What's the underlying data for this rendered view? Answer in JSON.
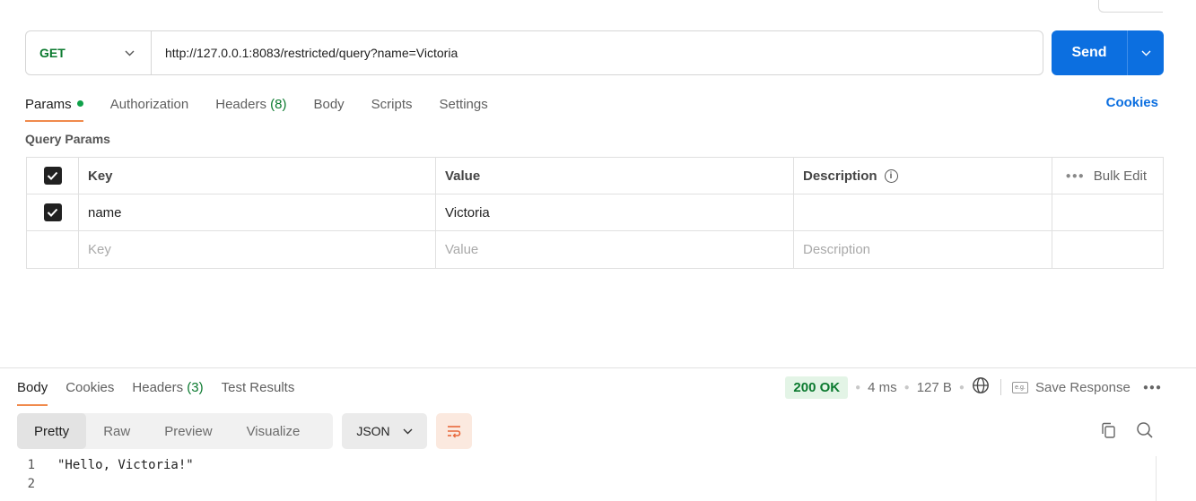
{
  "request": {
    "method": "GET",
    "url": "http://127.0.0.1:8083/restricted/query?name=Victoria",
    "send_label": "Send"
  },
  "request_tabs": [
    {
      "label": "Params",
      "active": true,
      "has_dot": true
    },
    {
      "label": "Authorization"
    },
    {
      "label": "Headers",
      "count": "(8)"
    },
    {
      "label": "Body"
    },
    {
      "label": "Scripts"
    },
    {
      "label": "Settings"
    }
  ],
  "cookies_link": "Cookies",
  "query_params": {
    "title": "Query Params",
    "headers": {
      "key": "Key",
      "value": "Value",
      "description": "Description",
      "bulk_edit": "Bulk Edit"
    },
    "rows": [
      {
        "checked": true,
        "key": "name",
        "value": "Victoria",
        "description": ""
      }
    ],
    "placeholder": {
      "key": "Key",
      "value": "Value",
      "description": "Description"
    }
  },
  "response_tabs": [
    {
      "label": "Body",
      "active": true
    },
    {
      "label": "Cookies"
    },
    {
      "label": "Headers",
      "count": "(3)"
    },
    {
      "label": "Test Results"
    }
  ],
  "response_meta": {
    "status": "200 OK",
    "time": "4 ms",
    "size": "127 B",
    "save_response": "Save Response"
  },
  "view_modes": [
    "Pretty",
    "Raw",
    "Preview",
    "Visualize"
  ],
  "active_view": "Pretty",
  "format": "JSON",
  "body_lines": [
    "\"Hello, Victoria!\"",
    ""
  ],
  "colors": {
    "accent": "#0c6fe0",
    "method": "#0b7a2f",
    "tab_underline": "#f08a4c",
    "status_bg": "#e3f4e6"
  }
}
